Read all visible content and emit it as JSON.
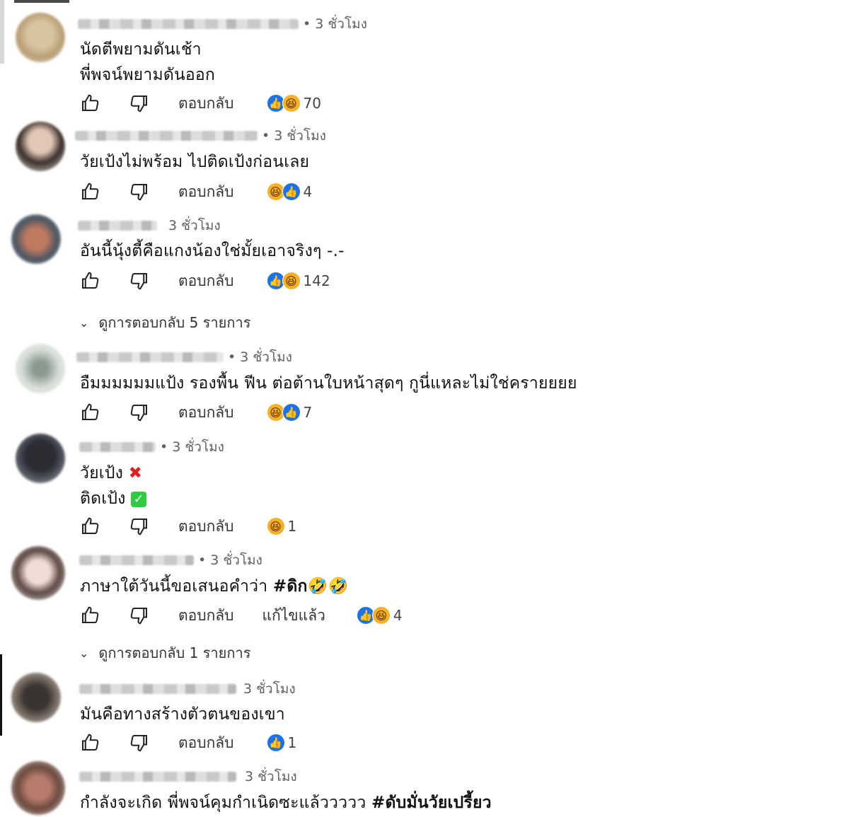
{
  "actions": {
    "reply_label": "ตอบกลับ",
    "edited_label": "แก้ไขแล้ว"
  },
  "reaction_colors": {
    "like": "#1a73e8",
    "haha": "#f7b125"
  },
  "comments": [
    {
      "timestamp": "• 3 ชั่วโมง",
      "lines": [
        "นัดตีพยามดันเช้า",
        "พี่พจน์พยามดันออก"
      ],
      "reactions": [
        "like",
        "haha"
      ],
      "count": "70"
    },
    {
      "timestamp": "• 3 ชั่วโมง",
      "lines": [
        "วัยเป้งไม่พร้อม ไปติดเป้งก่อนเลย"
      ],
      "reactions": [
        "haha",
        "like"
      ],
      "count": "4"
    },
    {
      "timestamp": "3 ชั่วโมง",
      "lines": [
        "อันนี้นุ้งตี้คือแกงน้องใช่มั้ยเอาจริงๆ -.-"
      ],
      "reactions": [
        "like",
        "haha"
      ],
      "count": "142"
    },
    {
      "timestamp": "• 3 ชั่วโมง",
      "lines": [
        "อืมมมมมมแป้ง รองพื้น ฟีน ต่อต้านใบหน้าสุดๆ กูนี่แหละไม่ใช่ครายยยย"
      ],
      "reactions": [
        "haha",
        "like"
      ],
      "count": "7"
    },
    {
      "timestamp": "• 3 ชั่วโมง",
      "lines": [
        "วัยเป้ง",
        "ติดเป้ง"
      ],
      "reactions": [
        "haha"
      ],
      "count": "1"
    },
    {
      "timestamp": "• 3 ชั่วโมง",
      "lines": [
        "ภาษาใต้วันนี้ขอเสนอคำว่า",
        "#ดิก"
      ],
      "reactions": [
        "like",
        "haha"
      ],
      "count": "4"
    },
    {
      "timestamp": "3 ชั่วโมง",
      "lines": [
        "มันคือทางสร้างตัวตนของเขา"
      ],
      "reactions": [
        "like"
      ],
      "count": "1"
    },
    {
      "timestamp": "3 ชั่วโมง",
      "lines": [
        "กำลังจะเกิด พี่พจน์คุมกำเนิดซะแล้ววววว",
        "#ดับมั่นวัยเปรี้ยว"
      ]
    }
  ],
  "view_replies": [
    "ดูการตอบกลับ 5 รายการ",
    "ดูการตอบกลับ 1 รายการ"
  ]
}
